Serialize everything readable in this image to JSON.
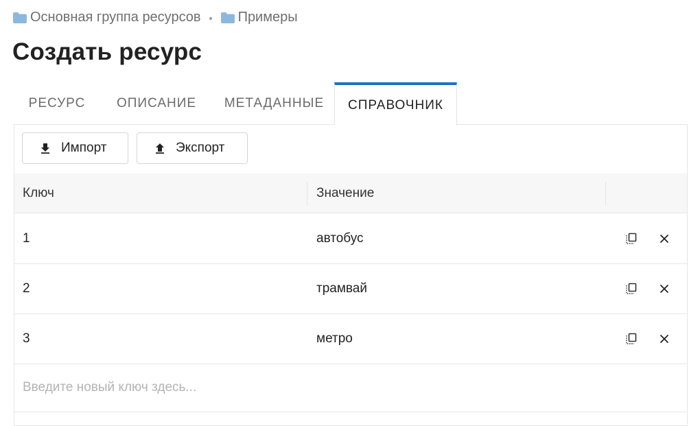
{
  "breadcrumb": {
    "items": [
      {
        "label": "Основная группа ресурсов",
        "icon": "folder-icon"
      },
      {
        "label": "Примеры",
        "icon": "folder-icon"
      }
    ],
    "folder_color": "#8cb8df"
  },
  "page_title": "Создать ресурс",
  "tabs": [
    {
      "label": "РЕСУРС",
      "active": false
    },
    {
      "label": "ОПИСАНИЕ",
      "active": false
    },
    {
      "label": "МЕТАДАННЫЕ",
      "active": false
    },
    {
      "label": "СПРАВОЧНИК",
      "active": true
    }
  ],
  "accent_color": "#1f72c0",
  "toolbar": {
    "import_label": "Импорт",
    "import_icon": "download-icon",
    "export_label": "Экспорт",
    "export_icon": "upload-icon"
  },
  "table": {
    "columns": [
      "Ключ",
      "Значение"
    ],
    "rows": [
      {
        "key": "1",
        "value": "автобус"
      },
      {
        "key": "2",
        "value": "трамвай"
      },
      {
        "key": "3",
        "value": "метро"
      }
    ],
    "row_actions": [
      "copy-icon",
      "close-icon"
    ]
  },
  "new_key": {
    "value": "",
    "placeholder": "Введите новый ключ здесь..."
  }
}
